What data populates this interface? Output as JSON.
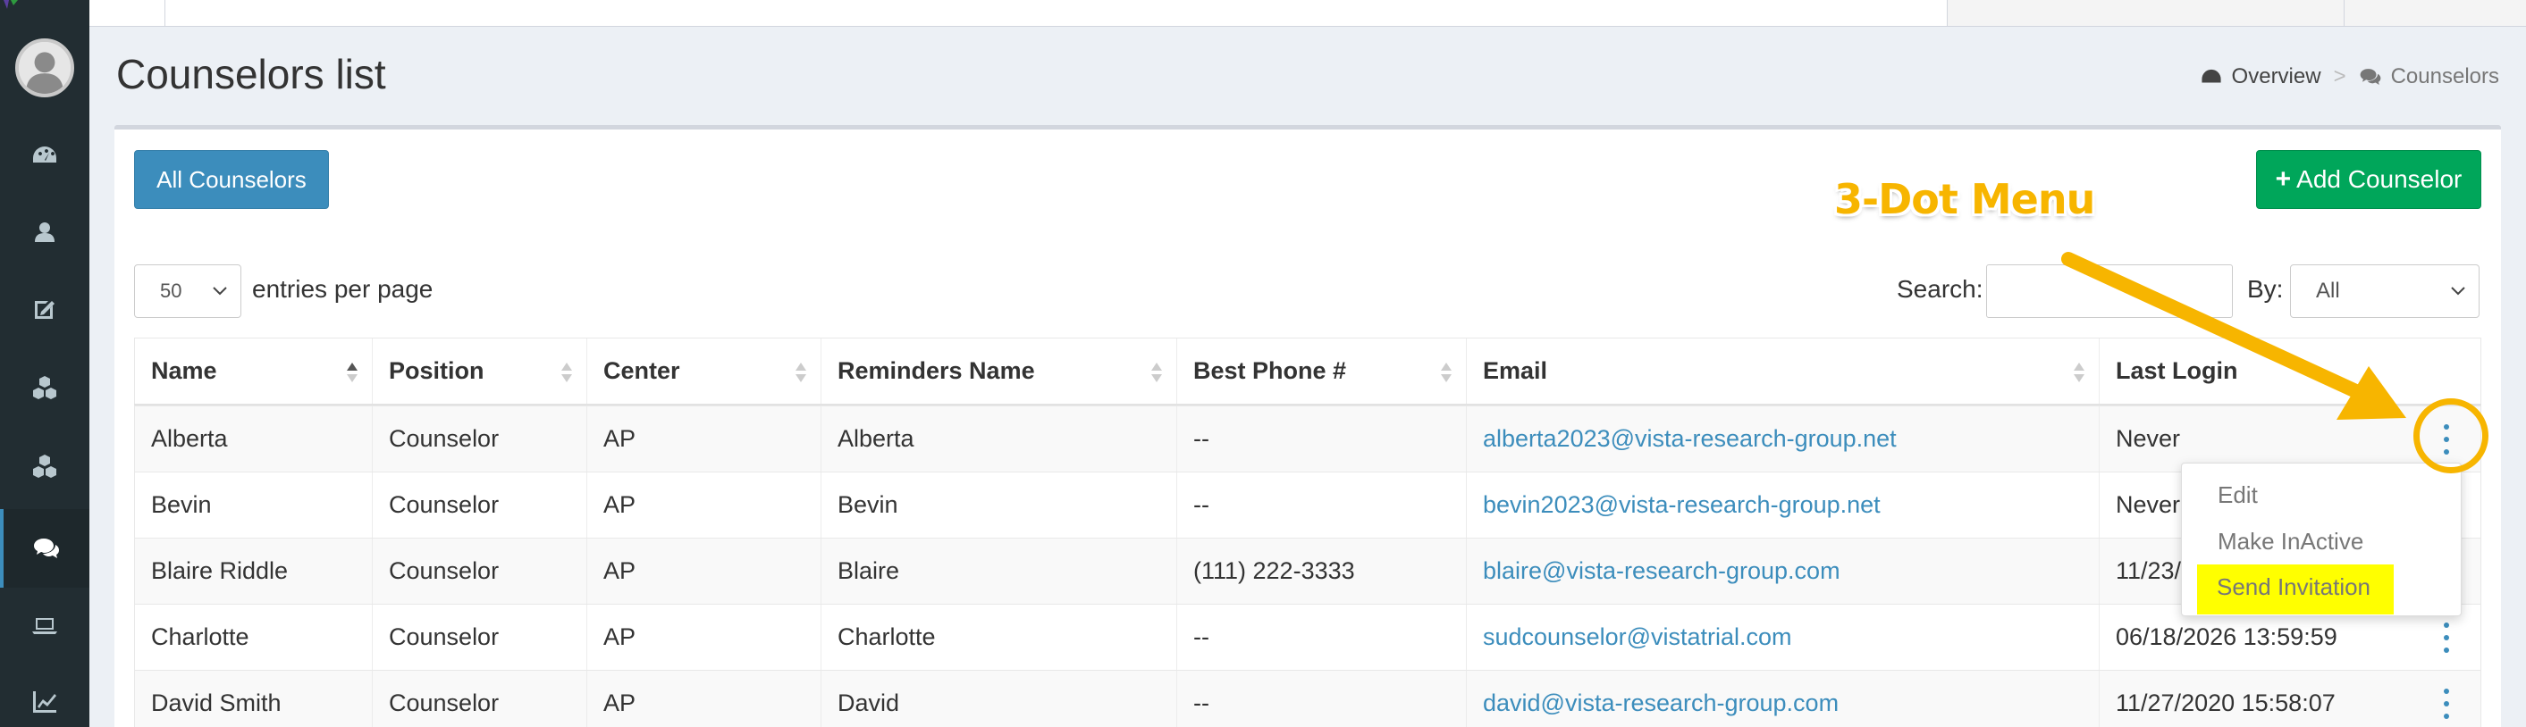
{
  "sidebar": {
    "items": [
      {
        "icon": "dashboard-icon"
      },
      {
        "icon": "user-icon"
      },
      {
        "icon": "edit-icon"
      },
      {
        "icon": "cubes-icon"
      },
      {
        "icon": "cubes-icon"
      },
      {
        "icon": "comments-icon",
        "active": true
      },
      {
        "icon": "laptop-icon"
      },
      {
        "icon": "line-chart-icon"
      }
    ]
  },
  "header": {
    "title": "Counselors list",
    "breadcrumb": {
      "overview": "Overview",
      "separator": ">",
      "current": "Counselors"
    }
  },
  "toolbar": {
    "all_counselors": "All Counselors",
    "add_counselor_plus": "+",
    "add_counselor": "Add Counselor"
  },
  "controls": {
    "entries_value": "50",
    "entries_label": "entries per page",
    "search_label": "Search:",
    "search_value": "",
    "by_label": "By:",
    "by_value": "All"
  },
  "table": {
    "columns": [
      "Name",
      "Position",
      "Center",
      "Reminders Name",
      "Best Phone #",
      "Email",
      "Last Login"
    ],
    "rows": [
      {
        "name": "Alberta",
        "position": "Counselor",
        "center": "AP",
        "reminders": "Alberta",
        "phone": "--",
        "email": "alberta2023@vista-research-group.net",
        "last_login": "Never"
      },
      {
        "name": "Bevin",
        "position": "Counselor",
        "center": "AP",
        "reminders": "Bevin",
        "phone": "--",
        "email": "bevin2023@vista-research-group.net",
        "last_login": "Never"
      },
      {
        "name": "Blaire Riddle",
        "position": "Counselor",
        "center": "AP",
        "reminders": "Blaire",
        "phone": "(111) 222-3333",
        "email": "blaire@vista-research-group.com",
        "last_login": "11/23/"
      },
      {
        "name": "Charlotte",
        "position": "Counselor",
        "center": "AP",
        "reminders": "Charlotte",
        "phone": "--",
        "email": "sudcounselor@vistatrial.com",
        "last_login": "06/18/2026 13:59:59"
      },
      {
        "name": "David Smith",
        "position": "Counselor",
        "center": "AP",
        "reminders": "David",
        "phone": "--",
        "email": "david@vista-research-group.com",
        "last_login": "11/27/2020 15:58:07"
      }
    ]
  },
  "dropdown": {
    "items": [
      "Edit",
      "Make InActive",
      "Send Invitation"
    ]
  },
  "annotation": {
    "label": "3-Dot Menu",
    "color": "#f7b500"
  },
  "colors": {
    "primary": "#3c8dbc",
    "success": "#00a65a",
    "sidebar": "#222d32",
    "highlight": "#ffff00"
  }
}
